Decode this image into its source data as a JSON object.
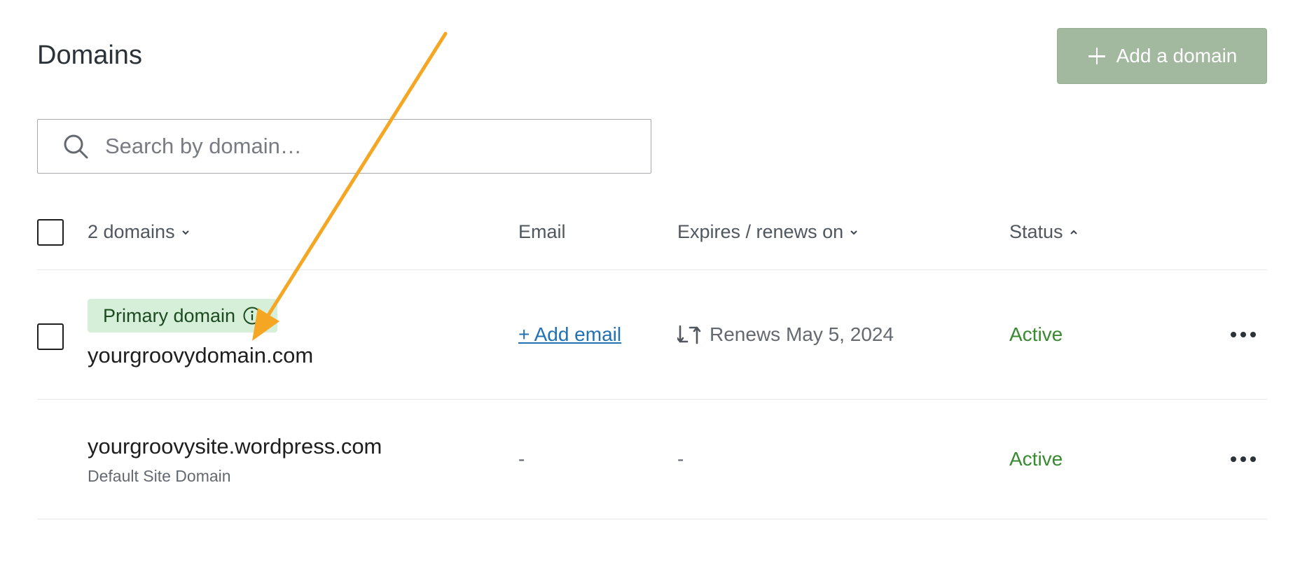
{
  "header": {
    "title": "Domains",
    "add_button_label": "Add a domain"
  },
  "search": {
    "placeholder": "Search by domain…",
    "value": ""
  },
  "table": {
    "columns": {
      "domains": "2 domains",
      "email": "Email",
      "expires": "Expires / renews on",
      "status": "Status"
    },
    "rows": [
      {
        "badge": "Primary domain",
        "domain": "yourgroovydomain.com",
        "email_action": "+ Add email",
        "expires": "Renews May 5, 2024",
        "status": "Active"
      },
      {
        "domain": "yourgroovysite.wordpress.com",
        "subtitle": "Default Site Domain",
        "email": "-",
        "expires": "-",
        "status": "Active"
      }
    ]
  },
  "colors": {
    "accent_button": "#a2b9a0",
    "status_active": "#378a2e",
    "link": "#2271b1",
    "badge_bg": "#d5efd8",
    "annotation_arrow": "#f5a623"
  },
  "icons": [
    "plus-icon",
    "search-icon",
    "chevron-down-icon",
    "chevron-up-icon",
    "info-icon",
    "auto-renew-icon",
    "more-horizontal-icon",
    "annotation-arrow"
  ]
}
